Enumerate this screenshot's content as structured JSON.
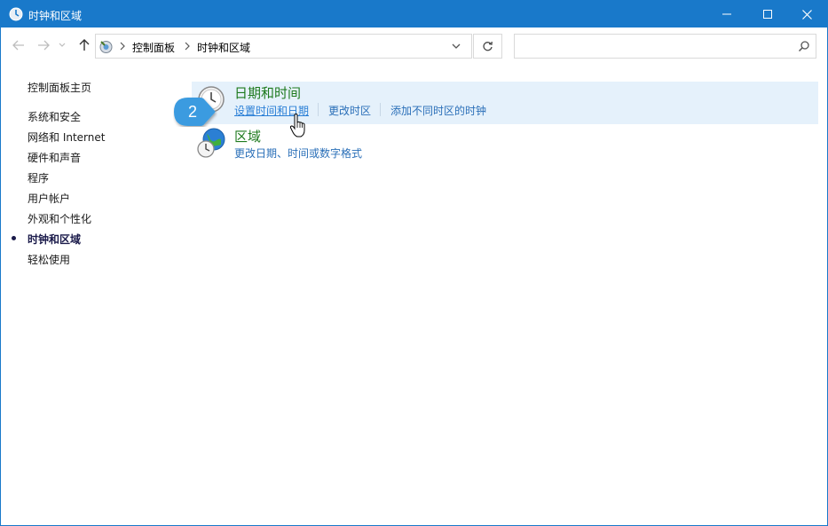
{
  "window": {
    "title": "时钟和区域"
  },
  "address_bar": {
    "crumbs": [
      "控制面板",
      "时钟和区域"
    ]
  },
  "search": {
    "placeholder": "",
    "value": ""
  },
  "left_nav": {
    "home": "控制面板主页",
    "items": [
      {
        "label": "系统和安全"
      },
      {
        "label": "网络和 Internet"
      },
      {
        "label": "硬件和声音"
      },
      {
        "label": "程序"
      },
      {
        "label": "用户帐户"
      },
      {
        "label": "外观和个性化"
      },
      {
        "label": "时钟和区域",
        "active": true
      },
      {
        "label": "轻松使用"
      }
    ]
  },
  "categories": [
    {
      "title": "日期和时间",
      "tasks": [
        "设置时间和日期",
        "更改时区",
        "添加不同时区的时钟"
      ],
      "icon": "clock-icon",
      "highlighted": true
    },
    {
      "title": "区域",
      "tasks": [
        "更改日期、时间或数字格式"
      ],
      "icon": "globe-clock-icon"
    }
  ],
  "step_badge": {
    "number": "2",
    "color": "#3a9be0"
  },
  "colors": {
    "titlebar": "#1979ca",
    "category_hover": "#e5f1fb",
    "category_title": "#1e7a1e",
    "link": "#2a6fb8"
  }
}
